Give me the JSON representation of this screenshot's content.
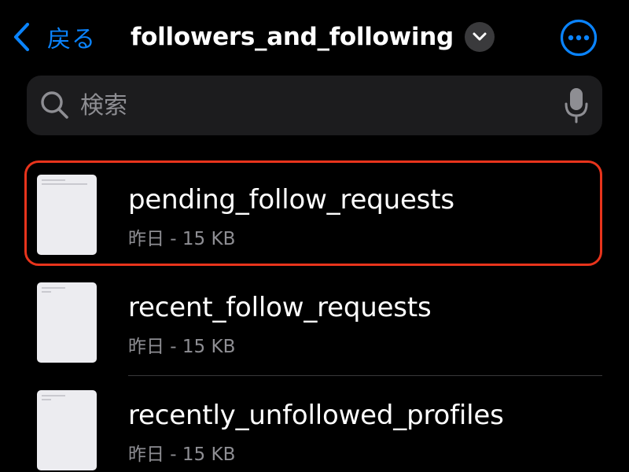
{
  "colors": {
    "accent": "#0a84ff",
    "background": "#000000",
    "secondary_text": "#8e8e93",
    "highlight": "#e8341c"
  },
  "navbar": {
    "back_label": "戻る",
    "back_icon": "chevron-left-icon",
    "title": "followers_and_following",
    "title_icon": "chevron-down-icon",
    "more_icon": "ellipsis-circle-icon"
  },
  "search": {
    "placeholder": "検索",
    "value": "",
    "search_icon": "search-icon",
    "mic_icon": "microphone-icon"
  },
  "files": [
    {
      "name": "pending_follow_requests",
      "meta": "昨日 - 15 KB",
      "highlighted": true
    },
    {
      "name": "recent_follow_requests",
      "meta": "昨日 - 15 KB",
      "highlighted": false
    },
    {
      "name": "recently_unfollowed_profiles",
      "meta": "昨日 - 15 KB",
      "highlighted": false
    }
  ]
}
